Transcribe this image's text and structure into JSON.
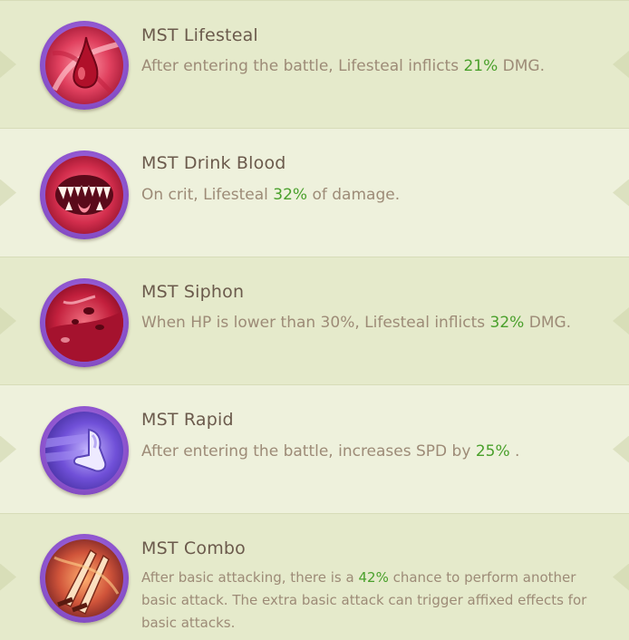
{
  "colors": {
    "highlight": "#4aa02c",
    "title": "#6b5a4c",
    "description": "#9d8b77",
    "icon_ring": "#8e55cf"
  },
  "skills": [
    {
      "icon": "blood-drop-icon",
      "title": "MST Lifesteal",
      "desc_before": "After entering the battle, Lifesteal inflicts ",
      "desc_value": "21%",
      "desc_after": " DMG."
    },
    {
      "icon": "fanged-mouth-icon",
      "title": "MST Drink Blood",
      "desc_before": "On crit, Lifesteal ",
      "desc_value": "32%",
      "desc_after": " of damage."
    },
    {
      "icon": "blood-splatter-icon",
      "title": "MST Siphon",
      "desc_before": "When HP is lower than 30%, Lifesteal inflicts ",
      "desc_value": "32%",
      "desc_after": " DMG."
    },
    {
      "icon": "winged-boot-icon",
      "title": "MST Rapid",
      "desc_before": "After entering the battle, increases SPD by ",
      "desc_value": "25%",
      "desc_after": " ."
    },
    {
      "icon": "double-blade-icon",
      "title": "MST Combo",
      "desc_before": "After basic attacking, there is a ",
      "desc_value": "42%",
      "desc_after": " chance to perform another basic attack. The extra basic attack can trigger affixed effects for basic attacks."
    }
  ]
}
